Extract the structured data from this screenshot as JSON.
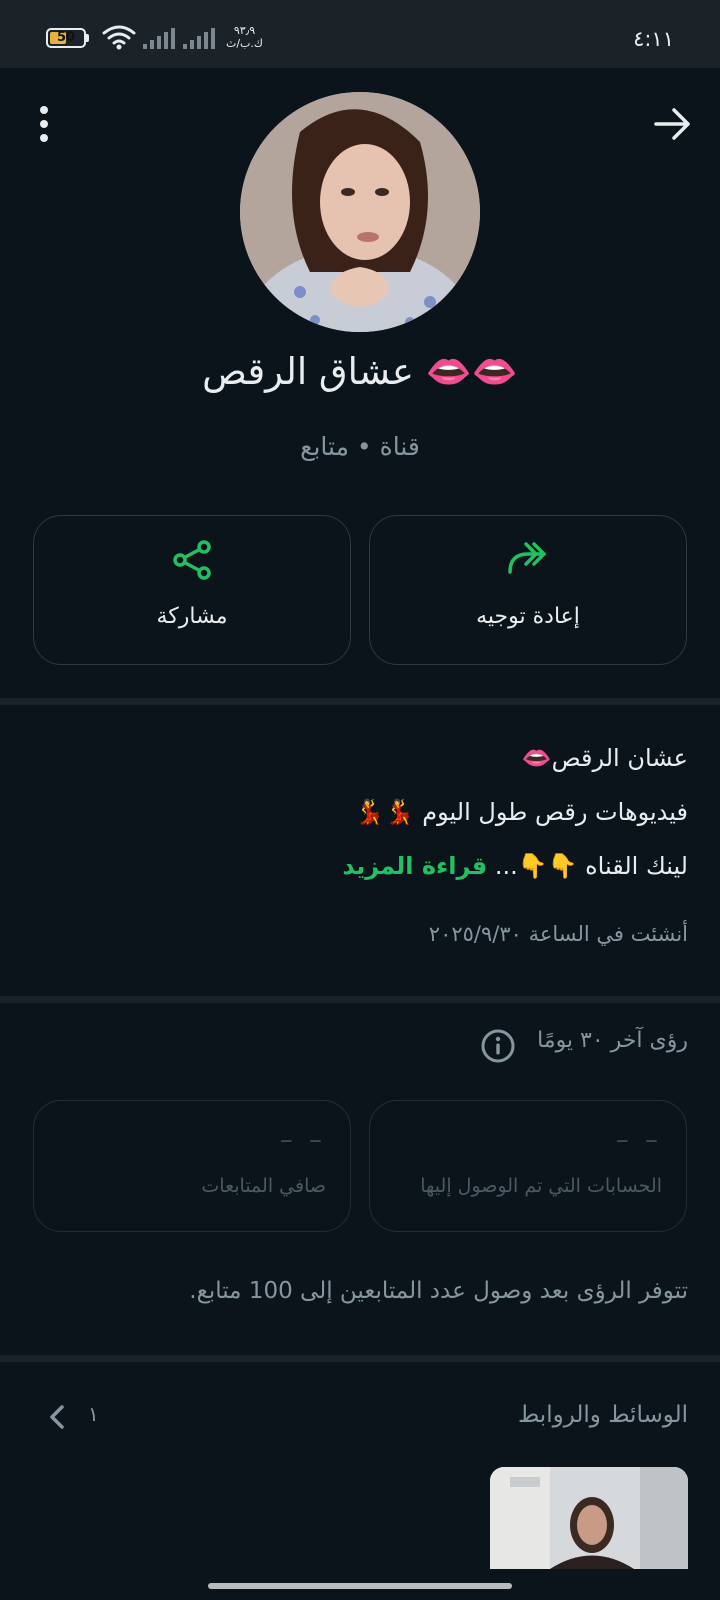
{
  "status_bar": {
    "time": "٤:١١",
    "battery": "50",
    "battery_level": 0.5,
    "speed_value": "٩٣٫٩",
    "speed_unit": "ك.ب/ث",
    "icons": [
      "battery-icon",
      "wifi-icon",
      "signal-icon",
      "signal-icon"
    ]
  },
  "header": {
    "more_icon": "more-vertical-icon",
    "back_icon": "arrow-right-icon"
  },
  "channel": {
    "name": "عشاق الرقص 👄👄",
    "subtitle": "قناة • متابع"
  },
  "actions": [
    {
      "label": "إعادة توجيه",
      "icon": "forward-icon"
    },
    {
      "label": "مشاركة",
      "icon": "share-icon"
    }
  ],
  "description": {
    "line1": "عشان الرقص👄",
    "line2": "فيديوهات رقص طول اليوم 💃💃",
    "line3": "لينك القناه 👇👇...",
    "read_more": "قراءة المزيد",
    "created": "أنشئت في الساعة ٢٠٢٥/٩/٣٠"
  },
  "insights": {
    "title": "رؤى آخر ٣٠ يومًا",
    "info_icon": "info-icon",
    "stats": [
      {
        "value": "– –",
        "label": "الحسابات التي تم الوصول إليها"
      },
      {
        "value": "– –",
        "label": "صافي المتابعات"
      }
    ],
    "notice": "تتوفر الرؤى بعد وصول عدد المتابعين إلى 100 متابع."
  },
  "media": {
    "title": "الوسائط والروابط",
    "count": "١"
  },
  "colors": {
    "background": "#0b141a",
    "accent": "#21c063",
    "divider": "#1b2228",
    "secondary_text": "#8696a0"
  }
}
